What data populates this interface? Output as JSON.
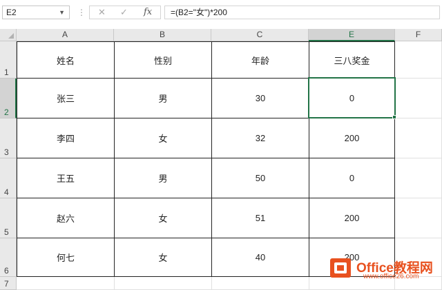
{
  "formula_bar": {
    "name_box": "E2",
    "cancel_icon": "close-icon",
    "enter_icon": "check-icon",
    "function_label": "fx",
    "formula": "=(B2=\"女\")*200"
  },
  "columns": [
    {
      "label": "A",
      "selected": false
    },
    {
      "label": "B",
      "selected": false
    },
    {
      "label": "C",
      "selected": false
    },
    {
      "label": "E",
      "selected": true
    },
    {
      "label": "F",
      "selected": false
    }
  ],
  "rows": [
    {
      "label": "1",
      "selected": false
    },
    {
      "label": "2",
      "selected": true
    },
    {
      "label": "3",
      "selected": false
    },
    {
      "label": "4",
      "selected": false
    },
    {
      "label": "5",
      "selected": false
    },
    {
      "label": "6",
      "selected": false
    },
    {
      "label": "7",
      "selected": false
    }
  ],
  "table": {
    "headers": [
      "姓名",
      "性别",
      "年龄",
      "三八奖金"
    ],
    "rows": [
      [
        "张三",
        "男",
        "30",
        "0"
      ],
      [
        "李四",
        "女",
        "32",
        "200"
      ],
      [
        "王五",
        "男",
        "50",
        "0"
      ],
      [
        "赵六",
        "女",
        "51",
        "200"
      ],
      [
        "何七",
        "女",
        "40",
        "200"
      ]
    ]
  },
  "active_cell": "E2",
  "colors": {
    "accent": "#217346",
    "watermark": "#e8511f"
  },
  "watermark": {
    "brand": "Office教程网",
    "site": "www.office26.com"
  }
}
